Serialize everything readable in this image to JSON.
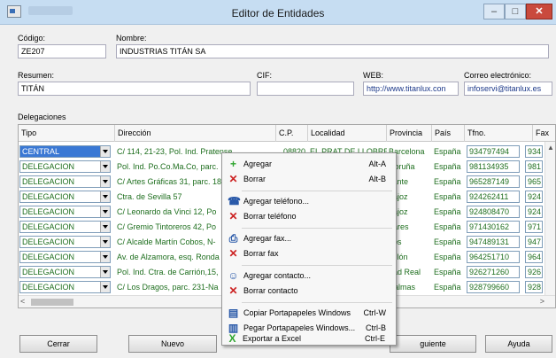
{
  "window": {
    "title": "Editor de Entidades",
    "min_glyph": "–",
    "max_glyph": "□",
    "close_glyph": "✕"
  },
  "form": {
    "codigo": {
      "label": "Código:",
      "value": "ZE207"
    },
    "nombre": {
      "label": "Nombre:",
      "value": "INDUSTRIAS TITÁN SA"
    },
    "resumen": {
      "label": "Resumen:",
      "value": "TITÁN"
    },
    "cif": {
      "label": "CIF:",
      "value": ""
    },
    "web": {
      "label": "WEB:",
      "value": "http://www.titanlux.con"
    },
    "correo": {
      "label": "Correo electrónico:",
      "value": "infoservi@titanlux.es"
    }
  },
  "delegaciones": {
    "section_label": "Delegaciones",
    "columns": [
      "Tipo",
      "Dirección",
      "C.P.",
      "Localidad",
      "Provincia",
      "País",
      "Tfno.",
      "Fax"
    ],
    "rows": [
      {
        "tipo": "CENTRAL",
        "direccion": "C/ 114, 21-23, Pol. Ind. Pratense",
        "cp": "08820",
        "localidad": "EL PRAT DE LLOBREGAT",
        "provincia": "Barcelona",
        "pais": "España",
        "tfno": "934797494",
        "fax": "934"
      },
      {
        "tipo": "DELEGACION",
        "direccion": "Pol. Ind. Po.Co.Ma.Co, parc.",
        "cp": "",
        "localidad": "",
        "provincia": "Coruña",
        "pais": "España",
        "tfno": "981134935",
        "fax": "981"
      },
      {
        "tipo": "DELEGACION",
        "direccion": "C/ Artes Gráficas 31, parc. 18",
        "cp": "",
        "localidad": "",
        "provincia": "cante",
        "pais": "España",
        "tfno": "965287149",
        "fax": "965"
      },
      {
        "tipo": "DELEGACION",
        "direccion": "Ctra. de Sevilla 57",
        "cp": "",
        "localidad": "",
        "provincia": "dajoz",
        "pais": "España",
        "tfno": "924262411",
        "fax": "924"
      },
      {
        "tipo": "DELEGACION",
        "direccion": "C/ Leonardo da Vinci 12, Po",
        "cp": "",
        "localidad": "",
        "provincia": "dajoz",
        "pais": "España",
        "tfno": "924808470",
        "fax": "924"
      },
      {
        "tipo": "DELEGACION",
        "direccion": "C/ Gremio Tintoreros 42, Po",
        "cp": "",
        "localidad": "",
        "provincia": "eares",
        "pais": "España",
        "tfno": "971430162",
        "fax": "971"
      },
      {
        "tipo": "DELEGACION",
        "direccion": "C/ Alcalde Martín Cobos, N-",
        "cp": "",
        "localidad": "",
        "provincia": "gos",
        "pais": "España",
        "tfno": "947489131",
        "fax": "947"
      },
      {
        "tipo": "DELEGACION",
        "direccion": "Av. de Alzamora, esq. Ronda",
        "cp": "",
        "localidad": "",
        "provincia": "tellón",
        "pais": "España",
        "tfno": "964251710",
        "fax": "964"
      },
      {
        "tipo": "DELEGACION",
        "direccion": "Pol. Ind. Ctra. de Carrión,15,",
        "cp": "",
        "localidad": "",
        "provincia": "dad Real",
        "pais": "España",
        "tfno": "926271260",
        "fax": "926"
      },
      {
        "tipo": "DELEGACION",
        "direccion": "C/ Los Dragos, parc. 231-Na",
        "cp": "",
        "localidad": "",
        "provincia": "Palmas",
        "pais": "España",
        "tfno": "928799660",
        "fax": "928"
      }
    ]
  },
  "context_menu": {
    "items": [
      {
        "icon": "+",
        "label": "Agregar",
        "shortcut": "Alt-A",
        "color": "g"
      },
      {
        "icon": "✕",
        "label": "Borrar",
        "shortcut": "Alt-B",
        "color": "r"
      },
      {
        "icon": "☎",
        "label": "Agregar teléfono...",
        "shortcut": "",
        "color": "b"
      },
      {
        "icon": "✕",
        "label": "Borrar teléfono",
        "shortcut": "",
        "color": "r"
      },
      {
        "icon": "⎙",
        "label": "Agregar fax...",
        "shortcut": "",
        "color": "b"
      },
      {
        "icon": "✕",
        "label": "Borrar fax",
        "shortcut": "",
        "color": "r"
      },
      {
        "icon": "☺",
        "label": "Agregar contacto...",
        "shortcut": "",
        "color": "b"
      },
      {
        "icon": "✕",
        "label": "Borrar contacto",
        "shortcut": "",
        "color": "r"
      },
      {
        "icon": "▤",
        "label": "Copiar Portapapeles Windows",
        "shortcut": "Ctrl-W",
        "color": "b"
      },
      {
        "icon": "▥",
        "label": "Pegar Portapapeles Windows...",
        "shortcut": "Ctrl-B",
        "color": "b"
      },
      {
        "icon": "X",
        "label": "Exportar a Excel",
        "shortcut": "Ctrl-E",
        "color": "g"
      }
    ]
  },
  "buttons": {
    "cerrar": "Cerrar",
    "nuevo": "Nuevo",
    "siguiente": "guiente",
    "ayuda": "Ayuda"
  }
}
